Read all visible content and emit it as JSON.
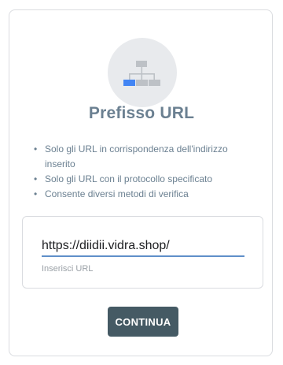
{
  "card": {
    "title": "Prefisso URL",
    "bullets": [
      "Solo gli URL in corrispondenza dell'indirizzo inserito",
      "Solo gli URL con il protocollo specificato",
      "Consente diversi metodi di verifica"
    ],
    "bullet_glyph": "•",
    "icon": "sitemap-hierarchy-icon",
    "url_input": {
      "value": "https://diidii.vidra.shop/",
      "helper": "Inserisci URL"
    },
    "continue_label": "CONTINUA"
  },
  "colors": {
    "title": "#6b8091",
    "button_bg": "#455a64",
    "input_underline": "#5f8fc9",
    "icon_highlight": "#4285f4",
    "icon_gray": "#bdc1c6"
  }
}
